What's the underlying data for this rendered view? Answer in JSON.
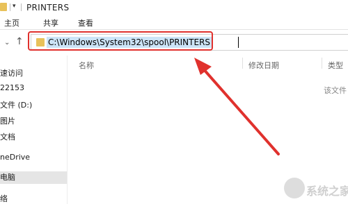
{
  "window": {
    "title": "PRINTERS",
    "quick_access_glyph": "▾"
  },
  "ribbon": {
    "tabs": [
      "主页",
      "共享",
      "查看"
    ]
  },
  "address_bar": {
    "path": "C:\\Windows\\System32\\spool\\PRINTERS"
  },
  "nav_pane": {
    "items": [
      "速访问",
      "22153",
      "文件 (D:)",
      "图片",
      "文档",
      "neDrive",
      "电脑",
      "络"
    ],
    "selected": "电脑"
  },
  "file_list": {
    "columns": [
      "名称",
      "修改日期",
      "类型"
    ],
    "empty_message": "该文件"
  },
  "watermark": {
    "text": "系统之家"
  },
  "colors": {
    "annotation": "#e0312d",
    "selection": "#cce4f7",
    "folder": "#e8c15a"
  }
}
